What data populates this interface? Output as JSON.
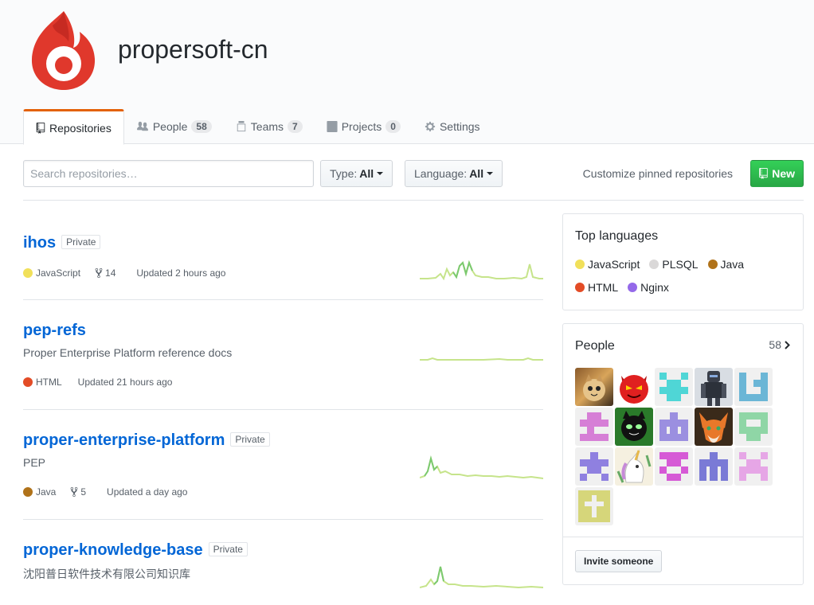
{
  "org": {
    "name": "propersoft-cn"
  },
  "tabs": [
    {
      "label": "Repositories",
      "count": null,
      "icon": "repo-icon"
    },
    {
      "label": "People",
      "count": "58",
      "icon": "people-icon"
    },
    {
      "label": "Teams",
      "count": "7",
      "icon": "teams-icon"
    },
    {
      "label": "Projects",
      "count": "0",
      "icon": "project-icon"
    },
    {
      "label": "Settings",
      "count": null,
      "icon": "gear-icon"
    }
  ],
  "filters": {
    "search_placeholder": "Search repositories…",
    "type_label": "Type:",
    "type_value": "All",
    "language_label": "Language:",
    "language_value": "All",
    "customize": "Customize pinned repositories",
    "new_label": "New"
  },
  "repos": [
    {
      "name": "ihos",
      "badge": "Private",
      "description": "",
      "language": "JavaScript",
      "lang_color": "#f1e05a",
      "forks": "14",
      "updated": "Updated 2 hours ago"
    },
    {
      "name": "pep-refs",
      "badge": "",
      "description": "Proper Enterprise Platform reference docs",
      "language": "HTML",
      "lang_color": "#e34c26",
      "forks": "",
      "updated": "Updated 21 hours ago"
    },
    {
      "name": "proper-enterprise-platform",
      "badge": "Private",
      "description": "PEP",
      "language": "Java",
      "lang_color": "#b07219",
      "forks": "5",
      "updated": "Updated a day ago"
    },
    {
      "name": "proper-knowledge-base",
      "badge": "Private",
      "description": "沈阳普日软件技术有限公司知识库",
      "language": "",
      "lang_color": "",
      "forks": "",
      "updated": ""
    }
  ],
  "sidebar": {
    "top_languages_title": "Top languages",
    "languages": [
      {
        "name": "JavaScript",
        "color": "#f1e05a"
      },
      {
        "name": "PLSQL",
        "color": "#dad8d8"
      },
      {
        "name": "Java",
        "color": "#b07219"
      },
      {
        "name": "HTML",
        "color": "#e34c26"
      },
      {
        "name": "Nginx",
        "color": "#9469e9"
      }
    ],
    "people_title": "People",
    "people_count": "58",
    "invite_label": "Invite someone"
  },
  "colors": {
    "accent": "#0366d6",
    "tab_active": "#e36209",
    "new_button": "#28a745",
    "sparkline": "#c6e48b",
    "sparkline_dark": "#7bc96f"
  }
}
